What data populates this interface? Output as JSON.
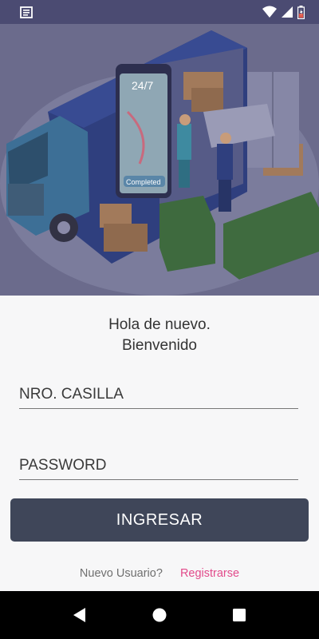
{
  "status_bar": {
    "left_icon": "news-icon",
    "right_icons": [
      "wifi-icon",
      "signal-icon",
      "battery-icon"
    ]
  },
  "hero": {
    "illustration": "delivery-truck-illustration",
    "phone_label": "24/7",
    "phone_badge": "Completed"
  },
  "welcome": {
    "line1": "Hola de nuevo.",
    "line2": "Bienvenido"
  },
  "login": {
    "username_placeholder": "NRO. CASILLA",
    "password_placeholder": "PASSWORD",
    "submit_label": "INGRESAR"
  },
  "signup": {
    "question": "Nuevo Usuario?",
    "link_label": "Registrarse"
  },
  "nav": {
    "back_icon": "back-icon",
    "home_icon": "home-icon",
    "recents_icon": "recents-icon"
  },
  "colors": {
    "button_bg": "#3f4659",
    "link": "#e24b8b",
    "hero_overlay": "#6c6c8d"
  }
}
